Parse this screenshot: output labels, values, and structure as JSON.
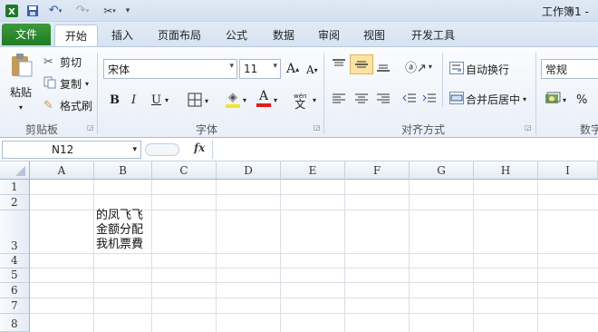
{
  "window": {
    "title": "工作簿1 - "
  },
  "tabs": [
    "文件",
    "开始",
    "插入",
    "页面布局",
    "公式",
    "数据",
    "审阅",
    "视图",
    "开发工具"
  ],
  "clipboard": {
    "paste": "粘贴",
    "cut": "剪切",
    "copy": "复制",
    "format_painter": "格式刷",
    "group_label": "剪贴板"
  },
  "font": {
    "name": "宋体",
    "size": "11",
    "bold": "B",
    "italic": "I",
    "underline": "U",
    "font_color_glyph": "A",
    "grow": "A",
    "shrink": "A",
    "phonetic": "wén",
    "group_label": "字体"
  },
  "alignment": {
    "wrap_text": "自动换行",
    "merge_center": "合并后居中",
    "group_label": "对齐方式"
  },
  "number": {
    "format": "常规",
    "percent": "%",
    "group_label": "数字"
  },
  "formula_bar": {
    "name_box": "N12",
    "fx": "fx"
  },
  "grid": {
    "columns": [
      "A",
      "B",
      "C",
      "D",
      "E",
      "F",
      "G",
      "H",
      "I"
    ],
    "rows": [
      "1",
      "2",
      "3",
      "4",
      "5",
      "6",
      "7",
      "8"
    ],
    "cell_B3": "的凤飞飞\n金额分配\n我机票費"
  },
  "colors": {
    "file_tab": "#2a8a2e",
    "accent_border": "#a8bcd6",
    "font_color_bar": "#e31b1b",
    "highlight_bar": "#f5e52a"
  }
}
